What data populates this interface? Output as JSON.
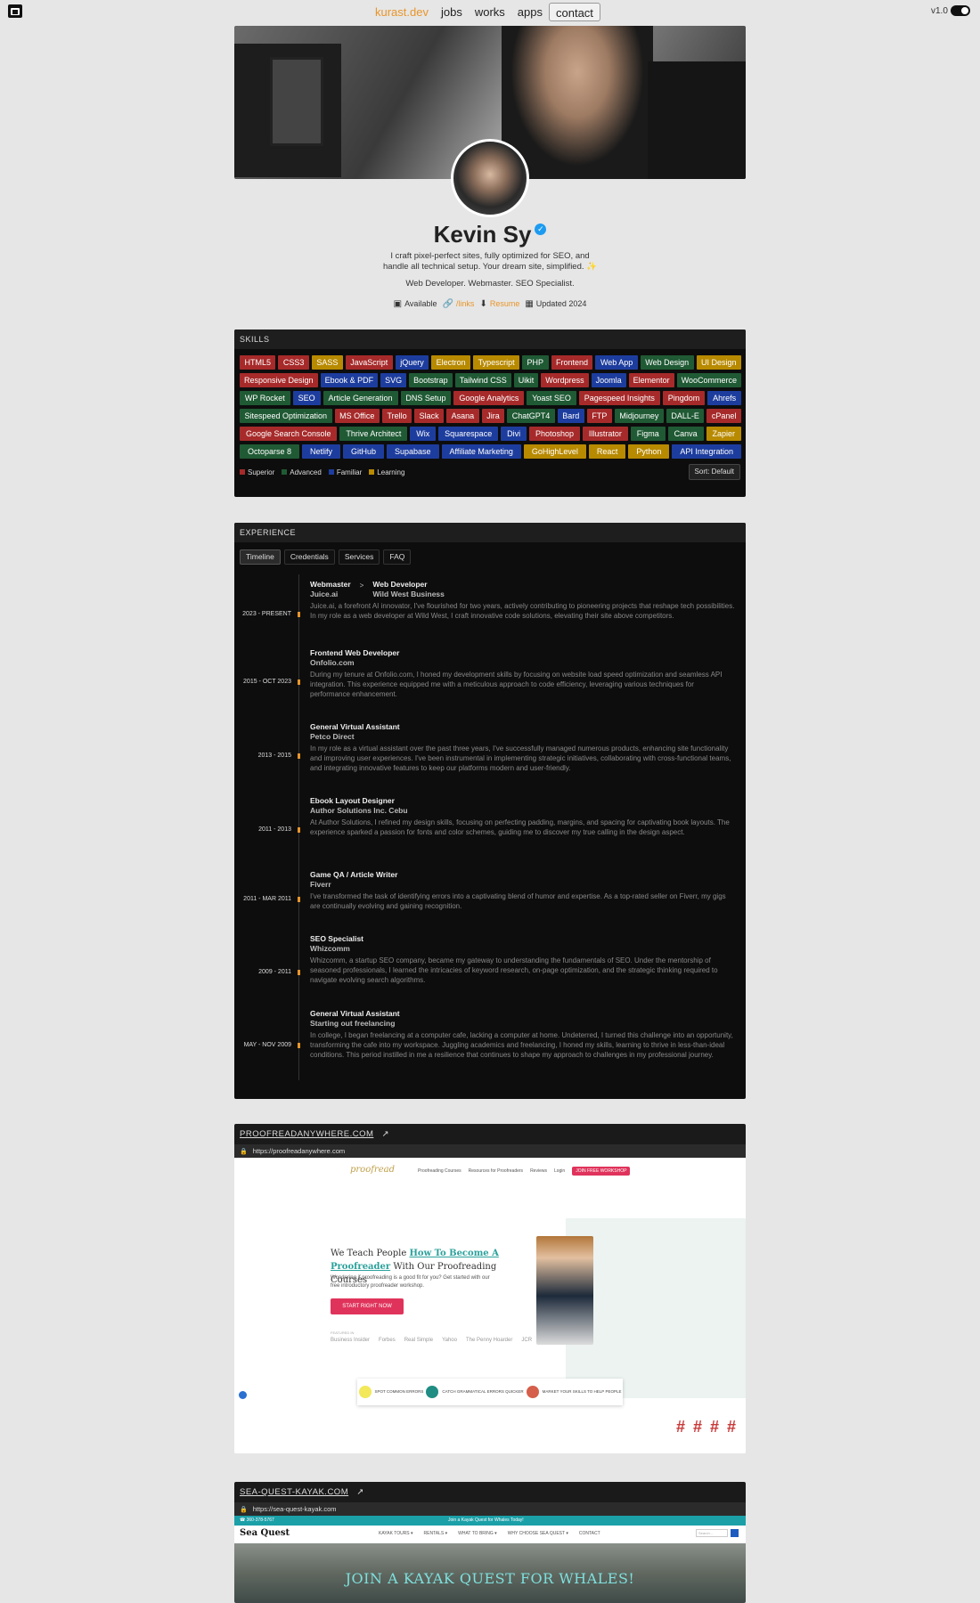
{
  "nav": {
    "brand": "kurast.dev",
    "items": [
      "jobs",
      "works",
      "apps",
      "contact"
    ],
    "version": "v1.0"
  },
  "profile": {
    "name": "Kevin Sy",
    "bio": "I craft pixel-perfect sites, fully optimized for SEO, and handle all technical setup. Your dream site, simplified. ✨",
    "roles": "Web Developer. Webmaster. SEO Specialist.",
    "meta": {
      "available": "Available",
      "links": "/links",
      "resume": "Resume",
      "updated": "Updated 2024"
    }
  },
  "skills": {
    "heading": "SKILLS",
    "chips": [
      {
        "label": "HTML5",
        "level": "red"
      },
      {
        "label": "CSS3",
        "level": "red"
      },
      {
        "label": "SASS",
        "level": "yellow"
      },
      {
        "label": "JavaScript",
        "level": "red"
      },
      {
        "label": "jQuery",
        "level": "blue"
      },
      {
        "label": "Electron",
        "level": "yellow"
      },
      {
        "label": "Typescript",
        "level": "yellow"
      },
      {
        "label": "PHP",
        "level": "green"
      },
      {
        "label": "Frontend",
        "level": "red"
      },
      {
        "label": "Web App",
        "level": "blue"
      },
      {
        "label": "Web Design",
        "level": "green"
      },
      {
        "label": "UI Design",
        "level": "yellow"
      },
      {
        "label": "Responsive Design",
        "level": "red"
      },
      {
        "label": "Ebook & PDF",
        "level": "blue"
      },
      {
        "label": "SVG",
        "level": "blue"
      },
      {
        "label": "Bootstrap",
        "level": "green"
      },
      {
        "label": "Tailwind CSS",
        "level": "green"
      },
      {
        "label": "Uikit",
        "level": "green"
      },
      {
        "label": "Wordpress",
        "level": "red"
      },
      {
        "label": "Joomla",
        "level": "blue"
      },
      {
        "label": "Elementor",
        "level": "red"
      },
      {
        "label": "WooCommerce",
        "level": "green"
      },
      {
        "label": "WP Rocket",
        "level": "green"
      },
      {
        "label": "SEO",
        "level": "blue"
      },
      {
        "label": "Article Generation",
        "level": "green"
      },
      {
        "label": "DNS Setup",
        "level": "green"
      },
      {
        "label": "Google Analytics",
        "level": "red"
      },
      {
        "label": "Yoast SEO",
        "level": "green"
      },
      {
        "label": "Pagespeed Insights",
        "level": "red"
      },
      {
        "label": "Pingdom",
        "level": "red"
      },
      {
        "label": "Ahrefs",
        "level": "blue"
      },
      {
        "label": "Sitespeed Optimization",
        "level": "green"
      },
      {
        "label": "MS Office",
        "level": "red"
      },
      {
        "label": "Trello",
        "level": "red"
      },
      {
        "label": "Slack",
        "level": "red"
      },
      {
        "label": "Asana",
        "level": "red"
      },
      {
        "label": "Jira",
        "level": "red"
      },
      {
        "label": "ChatGPT4",
        "level": "green"
      },
      {
        "label": "Bard",
        "level": "blue"
      },
      {
        "label": "FTP",
        "level": "red"
      },
      {
        "label": "Midjourney",
        "level": "green"
      },
      {
        "label": "DALL-E",
        "level": "green"
      },
      {
        "label": "cPanel",
        "level": "red"
      },
      {
        "label": "Google Search Console",
        "level": "red"
      },
      {
        "label": "Thrive Architect",
        "level": "green"
      },
      {
        "label": "Wix",
        "level": "blue"
      },
      {
        "label": "Squarespace",
        "level": "blue"
      },
      {
        "label": "Divi",
        "level": "blue"
      },
      {
        "label": "Photoshop",
        "level": "red"
      },
      {
        "label": "Illustrator",
        "level": "red"
      },
      {
        "label": "Figma",
        "level": "green"
      },
      {
        "label": "Canva",
        "level": "green"
      },
      {
        "label": "Zapier",
        "level": "yellow"
      },
      {
        "label": "Octoparse 8",
        "level": "green"
      },
      {
        "label": "Netlify",
        "level": "blue"
      },
      {
        "label": "GitHub",
        "level": "blue"
      },
      {
        "label": "Supabase",
        "level": "blue"
      },
      {
        "label": "Affiliate Marketing",
        "level": "blue"
      },
      {
        "label": "GoHighLevel",
        "level": "yellow"
      },
      {
        "label": "React",
        "level": "yellow"
      },
      {
        "label": "Python",
        "level": "yellow"
      },
      {
        "label": "API Integration",
        "level": "blue"
      }
    ],
    "legend": [
      {
        "label": "Superior",
        "color": "#a72a2a"
      },
      {
        "label": "Advanced",
        "color": "#1f5a34"
      },
      {
        "label": "Familiar",
        "color": "#1d3d9e"
      },
      {
        "label": "Learning",
        "color": "#b88a00"
      }
    ],
    "sort_label": "Sort: Default"
  },
  "experience": {
    "heading": "EXPERIENCE",
    "tabs": [
      "Timeline",
      "Credentials",
      "Services",
      "FAQ"
    ],
    "entries": [
      {
        "date": "2023 - PRESENT",
        "title": "Webmaster",
        "company": "Juice.ai",
        "title2": "Web Developer",
        "company2": "Wild West Business",
        "desc": "Juice.ai, a forefront AI innovator, I've flourished for two years, actively contributing to pioneering projects that reshape tech possibilities. In my role as a web developer at Wild West, I craft innovative code solutions, elevating their site above competitors."
      },
      {
        "date": "2015 - OCT 2023",
        "title": "Frontend Web Developer",
        "company": "Onfolio.com",
        "desc": "During my tenure at Onfolio.com, I honed my development skills by focusing on website load speed optimization and seamless API integration. This experience equipped me with a meticulous approach to code efficiency, leveraging various techniques for performance enhancement."
      },
      {
        "date": "2013 - 2015",
        "title": "General Virtual Assistant",
        "company": "Petco Direct",
        "desc": "In my role as a virtual assistant over the past three years, I've successfully managed numerous products, enhancing site functionality and improving user experiences. I've been instrumental in implementing strategic initiatives, collaborating with cross-functional teams, and integrating innovative features to keep our platforms modern and user-friendly."
      },
      {
        "date": "2011 - 2013",
        "title": "Ebook Layout Designer",
        "company": "Author Solutions Inc. Cebu",
        "desc": "At Author Solutions, I refined my design skills, focusing on perfecting padding, margins, and spacing for captivating book layouts. The experience sparked a passion for fonts and color schemes, guiding me to discover my true calling in the design aspect."
      },
      {
        "date": "2011 - MAR 2011",
        "title": "Game QA / Article Writer",
        "company": "Fiverr",
        "desc": "I've transformed the task of identifying errors into a captivating blend of humor and expertise. As a top-rated seller on Fiverr, my gigs are continually evolving and gaining recognition."
      },
      {
        "date": "2009 - 2011",
        "title": "SEO Specialist",
        "company": "Whizcomm",
        "desc": "Whizcomm, a startup SEO company, became my gateway to understanding the fundamentals of SEO. Under the mentorship of seasoned professionals, I learned the intricacies of keyword research, on-page optimization, and the strategic thinking required to navigate evolving search algorithms."
      },
      {
        "date": "MAY - NOV 2009",
        "title": "General Virtual Assistant",
        "company": "Starting out freelancing",
        "desc": "In college, I began freelancing at a computer cafe, lacking a computer at home. Undeterred, I turned this challenge into an opportunity, transforming the cafe into my workspace. Juggling academics and freelancing, I honed my skills, learning to thrive in less-than-ideal conditions. This period instilled in me a resilience that continues to shape my approach to challenges in my professional journey."
      }
    ]
  },
  "works": [
    {
      "domain": "PROOFREADANYWHERE.COM",
      "url": "https://proofreadanywhere.com",
      "logo": "proofread",
      "nav": [
        "Proofreading Courses",
        "Resources for Proofreaders",
        "Reviews",
        "Login"
      ],
      "nav_cta": "JOIN FREE WORKSHOP",
      "headline_a": "We Teach People ",
      "headline_hl": "How To Become A Proofreader",
      "headline_b": " With Our Proofreading Courses",
      "sub": "Wondering if proofreading is a good fit for you? Get started with our free introductory proofreader workshop.",
      "cta": "START RIGHT NOW",
      "featured": "FEATURED IN",
      "press": [
        "Business Insider",
        "Forbes",
        "Real Simple",
        "Yahoo",
        "The Penny Hoarder",
        "JCR"
      ],
      "features": [
        "SPOT COMMON ERRORS",
        "CATCH GRAMMATICAL ERRORS QUICKER",
        "MARKET YOUR SKILLS TO HELP PEOPLE"
      ],
      "hash": "# # # #"
    },
    {
      "domain": "SEA-QUEST-KAYAK.COM",
      "url": "https://sea-quest-kayak.com",
      "topbar_phone": "360-378-5767",
      "topbar_mid": "Join a Kayak Quest for Whales Today!",
      "logo": "Sea Quest",
      "menu": [
        "KAYAK TOURS ▾",
        "RENTALS ▾",
        "WHAT TO BRING ▾",
        "WHY CHOOSE SEA QUEST ▾",
        "CONTACT"
      ],
      "search_placeholder": "Search...",
      "hero": "JOIN A KAYAK QUEST FOR WHALES!"
    }
  ]
}
